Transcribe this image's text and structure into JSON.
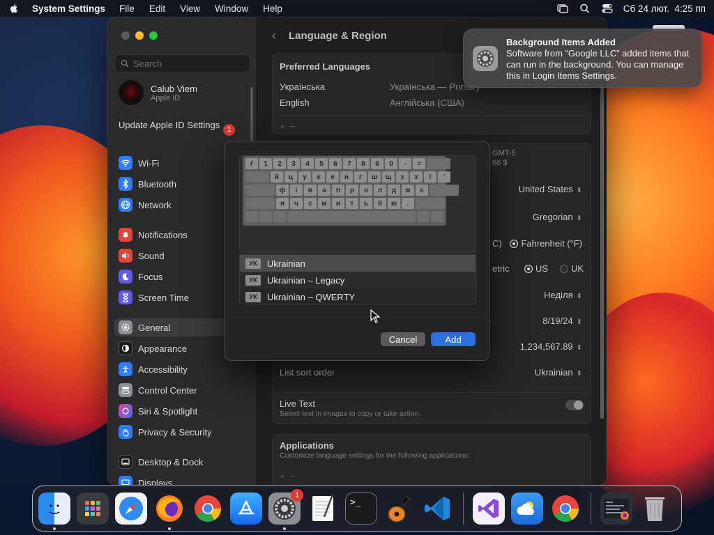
{
  "menubar": {
    "app_name": "System Settings",
    "menus": [
      "File",
      "Edit",
      "View",
      "Window",
      "Help"
    ],
    "clock": "Сб 24 лют.  4:25 пп"
  },
  "sidebar": {
    "search_placeholder": "Search",
    "user_name": "Calub Viem",
    "user_sub": "Apple ID",
    "update_label": "Update Apple ID Settings",
    "update_badge": "1",
    "items": [
      {
        "label": "Wi-Fi",
        "icon": "wifi-icon",
        "color": "#2f7cf6"
      },
      {
        "label": "Bluetooth",
        "icon": "bluetooth-icon",
        "color": "#2f7cf6"
      },
      {
        "label": "Network",
        "icon": "globe-icon",
        "color": "#2f7cf6"
      },
      {
        "label": "Notifications",
        "icon": "bell-icon",
        "color": "#e5443b"
      },
      {
        "label": "Sound",
        "icon": "speaker-icon",
        "color": "#e5443b"
      },
      {
        "label": "Focus",
        "icon": "moon-icon",
        "color": "#5e5ce6"
      },
      {
        "label": "Screen Time",
        "icon": "hourglass-icon",
        "color": "#5e5ce6"
      },
      {
        "label": "General",
        "icon": "gear-icon",
        "color": "#8e8e93"
      },
      {
        "label": "Appearance",
        "icon": "appearance-icon",
        "color": "#1c1c1e"
      },
      {
        "label": "Accessibility",
        "icon": "accessibility-icon",
        "color": "#2f7cf6"
      },
      {
        "label": "Control Center",
        "icon": "control-center-icon",
        "color": "#8e8e93"
      },
      {
        "label": "Siri & Spotlight",
        "icon": "siri-icon",
        "color": "#b84ae0"
      },
      {
        "label": "Privacy & Security",
        "icon": "hand-icon",
        "color": "#2f7cf6"
      },
      {
        "label": "Desktop & Dock",
        "icon": "dock-icon",
        "color": "#1c1c1e"
      },
      {
        "label": "Displays",
        "icon": "display-icon",
        "color": "#2f7cf6"
      }
    ]
  },
  "content": {
    "title": "Language & Region",
    "preferred_languages_title": "Preferred Languages",
    "languages": [
      {
        "name": "Українська",
        "detail": "Українська — Primary"
      },
      {
        "name": "English",
        "detail": "Англійська (США)"
      }
    ],
    "plus_minus": "+  −",
    "partial_time": "GMT-5",
    "partial_value": "66 $",
    "region": "United States",
    "calendar": "Gregorian",
    "temp_celsius_fragment": "C)",
    "temp_fahrenheit": "Fahrenheit (°F)",
    "measurement_fragment": "etric",
    "measurement_us": "US",
    "measurement_uk": "UK",
    "first_day": "Неділя",
    "date_format": "8/19/24",
    "number_format": "1,234,567.89",
    "list_sort_label": "List sort order",
    "list_sort_value": "Ukrainian",
    "live_text_label": "Live Text",
    "live_text_desc": "Select text in images to copy or take action.",
    "applications_title": "Applications",
    "applications_desc": "Customize language settings for the following applications:",
    "applications_plus": "+  −"
  },
  "sheet": {
    "keyboard_rows": [
      [
        "ґ",
        "1",
        "2",
        "3",
        "4",
        "5",
        "6",
        "7",
        "8",
        "9",
        "0",
        "-",
        "="
      ],
      [
        "й",
        "ц",
        "у",
        "к",
        "е",
        "н",
        "г",
        "ш",
        "щ",
        "з",
        "х",
        "ї",
        "'"
      ],
      [
        "ф",
        "і",
        "в",
        "а",
        "п",
        "р",
        "о",
        "л",
        "д",
        "ж",
        "є"
      ],
      [
        "я",
        "ч",
        "с",
        "м",
        "и",
        "т",
        "ь",
        "б",
        "ю",
        "."
      ]
    ],
    "layouts": [
      {
        "tag": "УК",
        "name": "Ukrainian"
      },
      {
        "tag": "УК",
        "name": "Ukrainian – Legacy"
      },
      {
        "tag": "УК",
        "name": "Ukrainian – QWERTY"
      }
    ],
    "cancel_label": "Cancel",
    "add_label": "Add"
  },
  "notification": {
    "title": "Background Items Added",
    "body": "Software from “Google LLC” added items that can run in the background. You can manage this in Login Items Settings."
  },
  "dock": {
    "apps": [
      "Finder",
      "Launchpad",
      "Safari",
      "Firefox",
      "Chrome",
      "App Store",
      "System Settings",
      "TextEdit",
      "Terminal",
      "GarageBand",
      "Visual Studio Code",
      "Visual Studio",
      "Weather",
      "Chrome",
      "Downloads Stack",
      "Trash"
    ],
    "settings_badge": "1",
    "terminal_prompt": ">_"
  }
}
